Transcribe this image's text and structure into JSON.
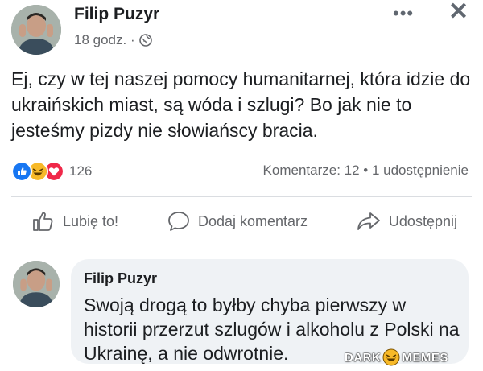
{
  "post": {
    "author": "Filip Puzyr",
    "time": "18 godz. ·",
    "privacy_icon": "globe-icon",
    "text": "Ej, czy w tej naszej pomocy humanitarnej, która idzie do ukraińskich miast, są wóda i szlugi? Bo jak nie to jesteśmy pizdy nie słowiańscy bracia.",
    "more_label": "•••",
    "close_label": "✕"
  },
  "reactions": {
    "count": "126",
    "icons": [
      "like-icon",
      "haha-icon",
      "love-icon"
    ],
    "colors": {
      "like": "#1877f2",
      "haha": "#f7b928",
      "love": "#f02849"
    }
  },
  "stats": {
    "text": "Komentarze: 12 • 1 udostępnienie"
  },
  "actions": {
    "like": "Lubię to!",
    "comment": "Dodaj komentarz",
    "share": "Udostępnij"
  },
  "comment": {
    "author": "Filip Puzyr",
    "text": "Swoją drogą to byłby chyba pierwszy w historii przerzut szlugów i alkoholu z Polski na Ukrainę, a nie odwrotnie."
  },
  "watermark": {
    "left": "DARK",
    "right": "MEMES"
  }
}
